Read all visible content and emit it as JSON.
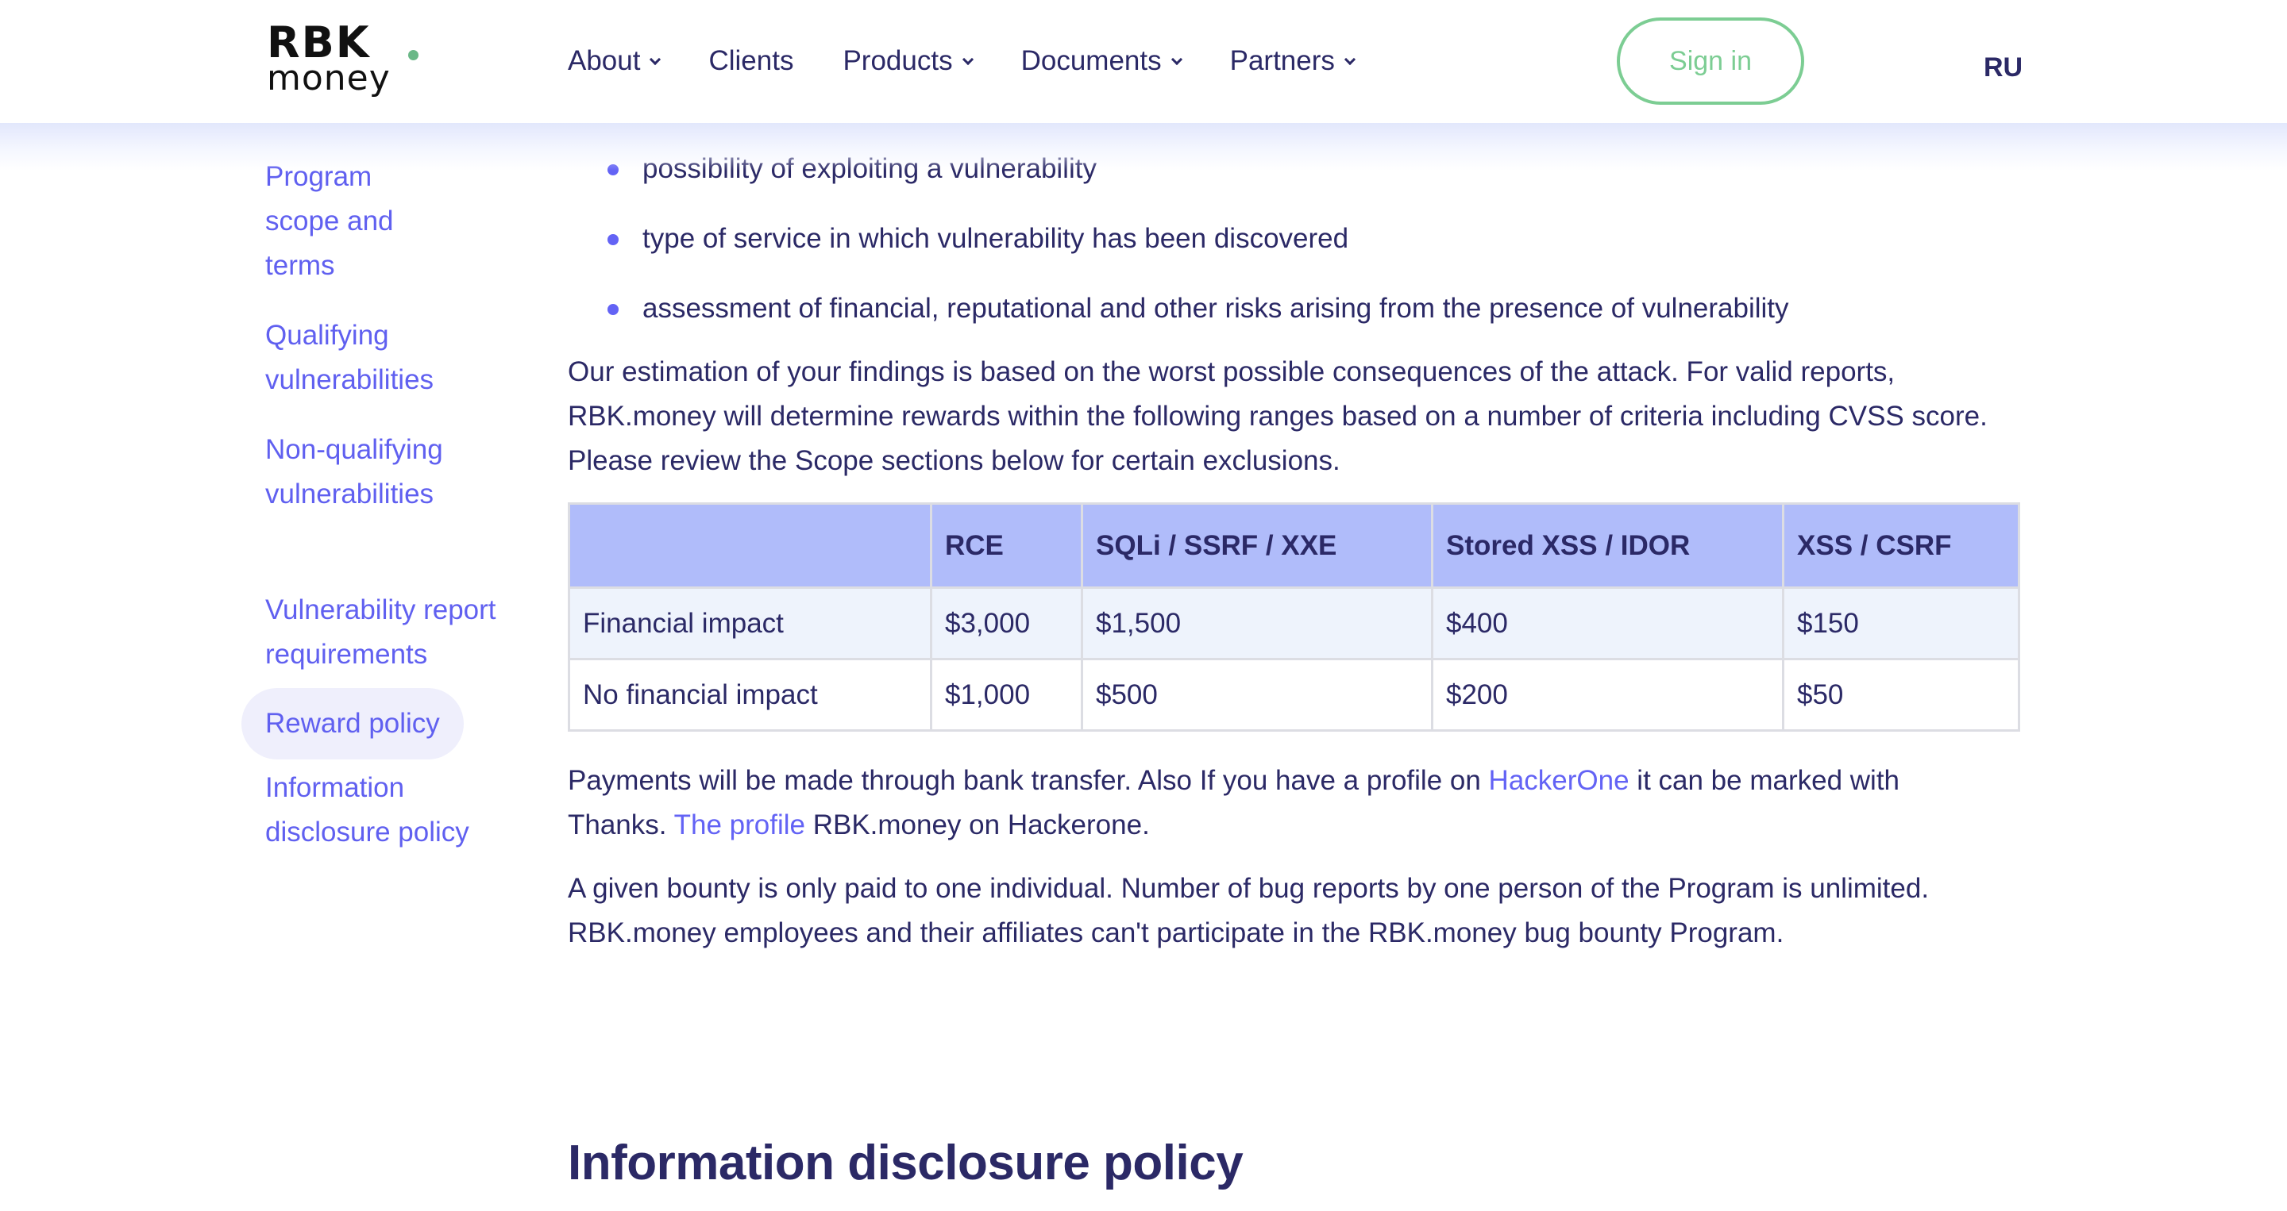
{
  "header": {
    "logo": {
      "top": "RBK",
      "bottom": "money",
      "dot_color": "#6ab887"
    },
    "nav": [
      {
        "label": "About",
        "has_dropdown": true
      },
      {
        "label": "Clients",
        "has_dropdown": false
      },
      {
        "label": "Products",
        "has_dropdown": true
      },
      {
        "label": "Documents",
        "has_dropdown": true
      },
      {
        "label": "Partners",
        "has_dropdown": true
      }
    ],
    "sign_in_label": "Sign in",
    "language_label": "RU"
  },
  "sidebar": {
    "items": [
      {
        "label": "Program scope and terms",
        "active": false
      },
      {
        "label": "Qualifying vulnerabilities",
        "active": false
      },
      {
        "label": "Non-qualifying vulnerabilities",
        "active": false
      },
      {
        "label": "Vulnerability report requirements",
        "active": false
      },
      {
        "label": "Reward policy",
        "active": true
      },
      {
        "label": "Information disclosure policy",
        "active": false
      }
    ]
  },
  "content": {
    "bullets": [
      "possibility of exploiting a vulnerability",
      "type of service in which vulnerability has been discovered",
      "assessment of financial, reputational and other risks arising from the presence of vulnerability"
    ],
    "estimation_paragraph": "Our estimation of your findings is based on the worst possible consequences of the attack. For valid reports, RBK.money will determine rewards within the following ranges based on a number of criteria including CVSS score. Please review the Scope sections below for certain exclusions.",
    "rewards_table": {
      "headers": [
        "",
        "RCE",
        "SQLi / SSRF / XXE",
        "Stored XSS / IDOR",
        "XSS / CSRF"
      ],
      "rows": [
        [
          "Financial impact",
          "$3,000",
          "$1,500",
          "$400",
          "$150"
        ],
        [
          "No financial impact",
          "$1,000",
          "$500",
          "$200",
          "$50"
        ]
      ]
    },
    "payments_paragraph": {
      "part1": "Payments will be made through bank transfer. Also If you have a profile on ",
      "link1": "HackerOne",
      "part2": " it can be marked with Thanks. ",
      "link2": "The profile",
      "part3": " RBK.money on Hackerone."
    },
    "bounty_paragraph": "A given bounty is only paid to one individual. Number of bug reports by one person of the Program is unlimited. RBK.money employees and their affiliates can't participate in the RBK.money bug bounty Program.",
    "next_section_title": "Information disclosure policy"
  },
  "colors": {
    "text": "#2b2966",
    "link": "#6363f5",
    "accent_green": "#7ccd93",
    "table_header_bg": "#b0bcfa",
    "table_row_alt_bg": "#eef3fc",
    "active_sidebar_bg": "#efeffc"
  }
}
